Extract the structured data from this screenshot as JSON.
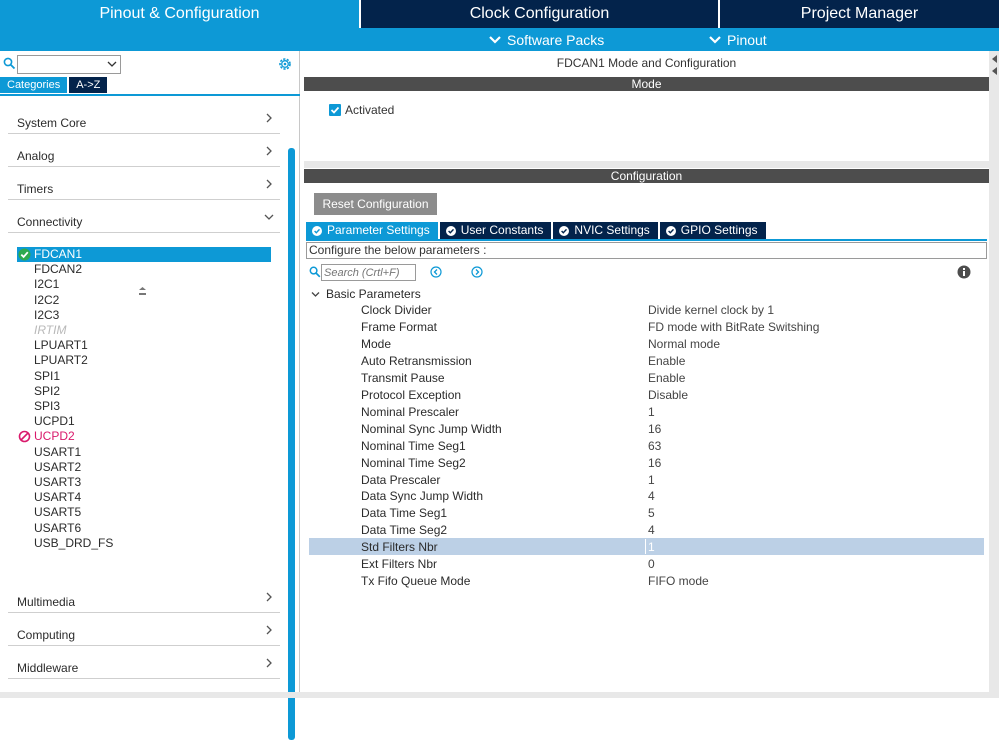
{
  "top_tabs": {
    "pinout": "Pinout & Configuration",
    "clock": "Clock Configuration",
    "project": "Project Manager"
  },
  "sub_tabs": {
    "software_packs": "Software Packs",
    "pinout": "Pinout"
  },
  "left": {
    "search_value": "",
    "view_tabs": [
      "Categories",
      "A->Z"
    ],
    "categories": [
      {
        "label": "System Core",
        "expanded": false
      },
      {
        "label": "Analog",
        "expanded": false
      },
      {
        "label": "Timers",
        "expanded": false
      },
      {
        "label": "Connectivity",
        "expanded": true
      },
      {
        "label": "Multimedia",
        "expanded": false
      },
      {
        "label": "Computing",
        "expanded": false
      },
      {
        "label": "Middleware",
        "expanded": false
      }
    ],
    "peripherals": [
      {
        "label": "FDCAN1",
        "state": "selected-ok"
      },
      {
        "label": "FDCAN2",
        "state": "normal"
      },
      {
        "label": "I2C1",
        "state": "normal"
      },
      {
        "label": "I2C2",
        "state": "normal"
      },
      {
        "label": "I2C3",
        "state": "normal"
      },
      {
        "label": "IRTIM",
        "state": "disabled"
      },
      {
        "label": "LPUART1",
        "state": "normal"
      },
      {
        "label": "LPUART2",
        "state": "normal"
      },
      {
        "label": "SPI1",
        "state": "normal"
      },
      {
        "label": "SPI2",
        "state": "normal"
      },
      {
        "label": "SPI3",
        "state": "normal"
      },
      {
        "label": "UCPD1",
        "state": "normal"
      },
      {
        "label": "UCPD2",
        "state": "conflict"
      },
      {
        "label": "USART1",
        "state": "normal"
      },
      {
        "label": "USART2",
        "state": "normal"
      },
      {
        "label": "USART3",
        "state": "normal"
      },
      {
        "label": "USART4",
        "state": "normal"
      },
      {
        "label": "USART5",
        "state": "normal"
      },
      {
        "label": "USART6",
        "state": "normal"
      },
      {
        "label": "USB_DRD_FS",
        "state": "normal"
      }
    ]
  },
  "right": {
    "title": "FDCAN1 Mode and Configuration",
    "mode_header": "Mode",
    "activated_label": "Activated",
    "activated_checked": true,
    "config_header": "Configuration",
    "reset_button": "Reset Configuration",
    "config_tabs": [
      "Parameter Settings",
      "User Constants",
      "NVIC Settings",
      "GPIO Settings"
    ],
    "active_tab": "Parameter Settings",
    "info_text": "Configure the below parameters :",
    "search_placeholder": "Search (Crtl+F)",
    "group_label": "Basic Parameters",
    "parameters": [
      {
        "name": "Clock Divider",
        "value": "Divide kernel clock by 1"
      },
      {
        "name": "Frame Format",
        "value": "FD mode with BitRate Switshing"
      },
      {
        "name": "Mode",
        "value": "Normal mode"
      },
      {
        "name": "Auto Retransmission",
        "value": "Enable"
      },
      {
        "name": "Transmit Pause",
        "value": "Enable"
      },
      {
        "name": "Protocol Exception",
        "value": "Disable"
      },
      {
        "name": "Nominal Prescaler",
        "value": "1"
      },
      {
        "name": "Nominal Sync Jump Width",
        "value": "16"
      },
      {
        "name": "Nominal Time Seg1",
        "value": "63"
      },
      {
        "name": "Nominal Time Seg2",
        "value": "16"
      },
      {
        "name": "Data Prescaler",
        "value": "1"
      },
      {
        "name": "Data Sync Jump Width",
        "value": "4"
      },
      {
        "name": "Data Time Seg1",
        "value": "5"
      },
      {
        "name": "Data Time Seg2",
        "value": "4"
      },
      {
        "name": "Std Filters Nbr",
        "value": "1",
        "highlighted": true
      },
      {
        "name": "Ext Filters Nbr",
        "value": "0"
      },
      {
        "name": "Tx Fifo Queue Mode",
        "value": "FIFO mode"
      }
    ]
  },
  "colors": {
    "accent_blue": "#0d99d6",
    "dark_navy": "#03234b",
    "section_header_gray": "#4d4d4d",
    "ok_green": "#2eaa4e",
    "conflict_magenta": "#d9196b",
    "row_highlight": "#bcd0e6"
  }
}
